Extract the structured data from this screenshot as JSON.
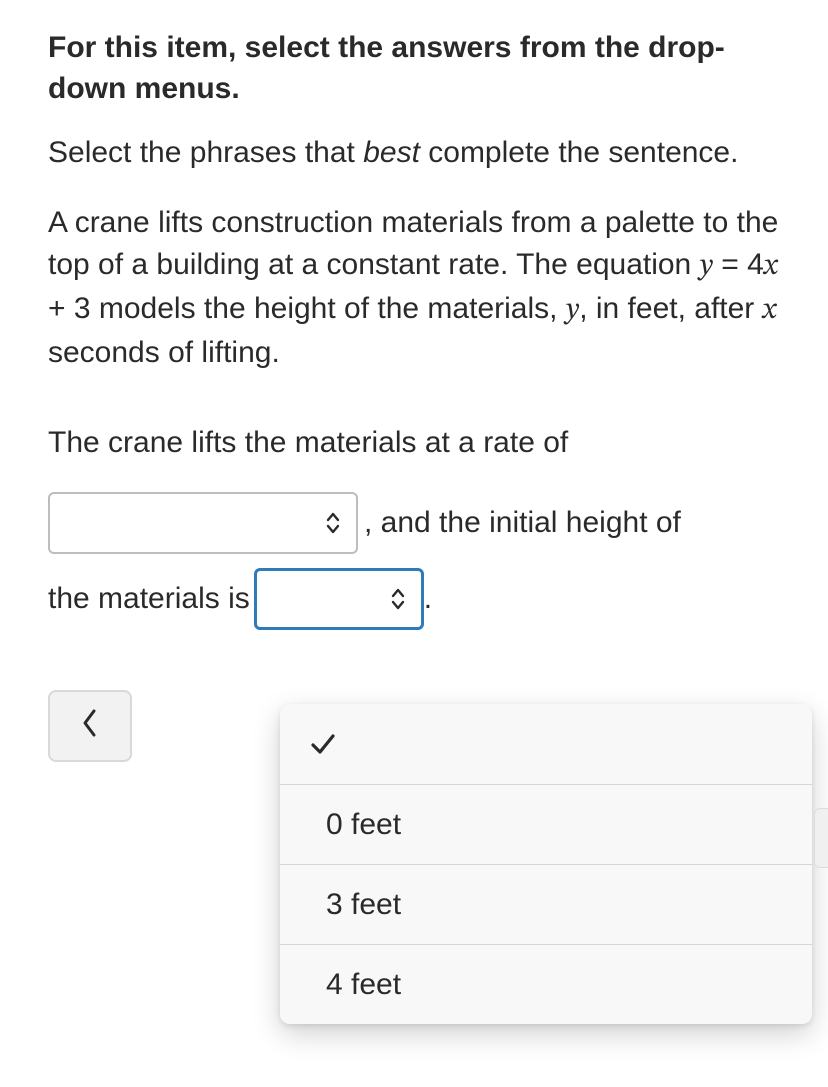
{
  "question": {
    "instruction_bold": "For this item, select the answers from the drop-down menus.",
    "instruction_sub_prefix": "Select the phrases that ",
    "instruction_sub_emph": "best",
    "instruction_sub_suffix": " complete the sentence.",
    "context_part1": "A crane lifts construction materials from a palette to the top of a building at a constant rate. The equation ",
    "context_eq_y": "y",
    "context_eq_eq": " = ",
    "context_eq_rhs1": "4",
    "context_eq_x": "x",
    "context_eq_rhs2": " + 3",
    "context_part2": " models the height of the materials, ",
    "context_y2": "y",
    "context_part3": ", in feet, after ",
    "context_x2": "x",
    "context_part4": " seconds of lifting.",
    "sentence_lead": "The crane lifts the materials at a rate of",
    "after_dd1": ", and the initial height of",
    "before_dd2": "the materials is",
    "after_dd2": "."
  },
  "dropdown1": {
    "selected": ""
  },
  "dropdown2": {
    "selected": "",
    "options": {
      "blank": "",
      "opt1": "0 feet",
      "opt2": "3 feet",
      "opt3": "4 feet"
    }
  }
}
